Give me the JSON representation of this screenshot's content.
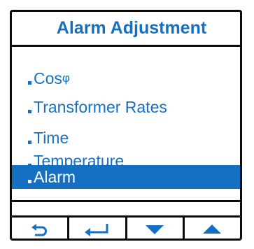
{
  "title": "Alarm Adjustment",
  "menu": {
    "items": [
      {
        "text": "Cos",
        "suffix": "φ",
        "selected": false
      },
      {
        "text": "Transformer Rates",
        "selected": false
      },
      {
        "text": "Time",
        "selected": false
      },
      {
        "text": "Temperature",
        "selected": false
      },
      {
        "text": "Alarm",
        "selected": true
      }
    ]
  },
  "softkeys": [
    {
      "icon": "back-arrow-icon"
    },
    {
      "icon": "enter-icon"
    },
    {
      "icon": "down-triangle-icon"
    },
    {
      "icon": "up-triangle-icon"
    }
  ],
  "colors": {
    "accent": "#1570c4",
    "border": "#0b0b0b",
    "background": "#ffffff"
  }
}
